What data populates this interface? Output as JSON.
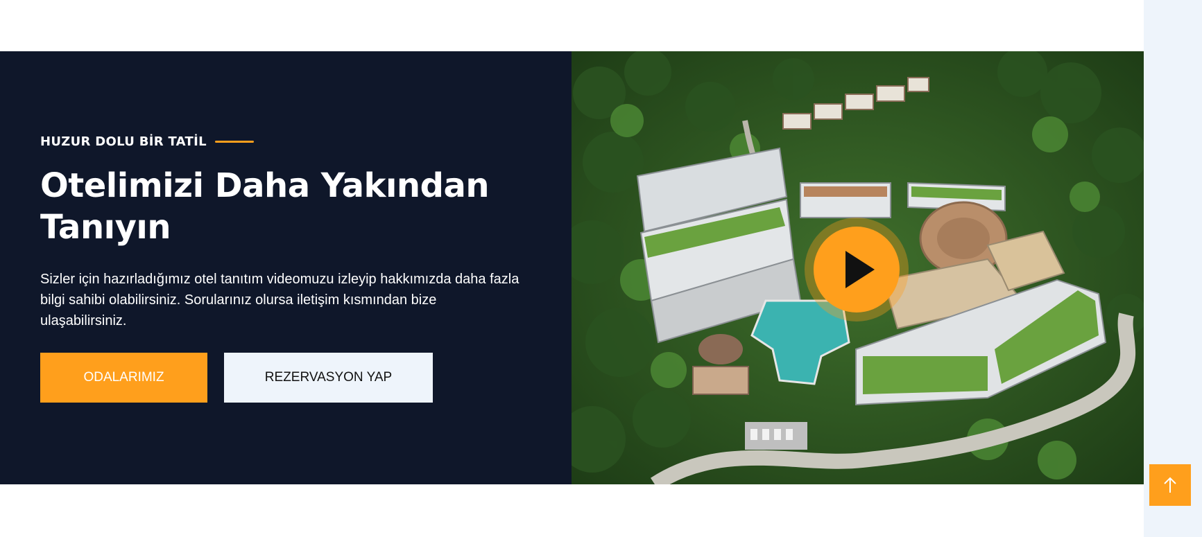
{
  "hero": {
    "eyebrow": "HUZUR DOLU BİR TATİL",
    "title": "Otelimizi Daha Yakından Tanıyın",
    "description": "Sizler için hazırladığımız otel tanıtım videomuzu izleyip hakkımızda daha fazla bilgi sahibi olabilirsiniz. Sorularınız olursa iletişim kısmından bize ulaşabilirsiniz.",
    "buttons": {
      "primary_label": "ODALARIMIZ",
      "secondary_label": "REZERVASYON YAP"
    }
  },
  "media": {
    "image_subject": "aerial-hotel-resort",
    "play_icon": "play-icon"
  },
  "scroll_top": {
    "icon": "arrow-up-icon"
  },
  "colors": {
    "accent": "#ff9f1c",
    "panel": "#0f172a",
    "light": "#eef4fb"
  }
}
